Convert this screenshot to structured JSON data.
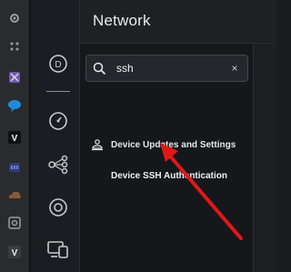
{
  "header": {
    "title": "Network"
  },
  "search": {
    "value": "ssh",
    "clear_glyph": "×"
  },
  "results": {
    "group_label": "Device Updates and Settings",
    "item_label": "Device SSH Authentication"
  },
  "launcher_icons": [
    "gear-icon",
    "dots-icon",
    "grid-icon",
    "slack-icon",
    "chat-icon",
    "v-icon",
    "media-icon",
    "cloud-icon",
    "camera-icon",
    "v-icon"
  ],
  "sidebar_icons": [
    "dashboard-icon",
    "speedometer-icon",
    "topology-icon",
    "target-icon",
    "devices-icon"
  ],
  "colors": {
    "brand": "#0f6fe6",
    "annotation": "#e01818"
  }
}
